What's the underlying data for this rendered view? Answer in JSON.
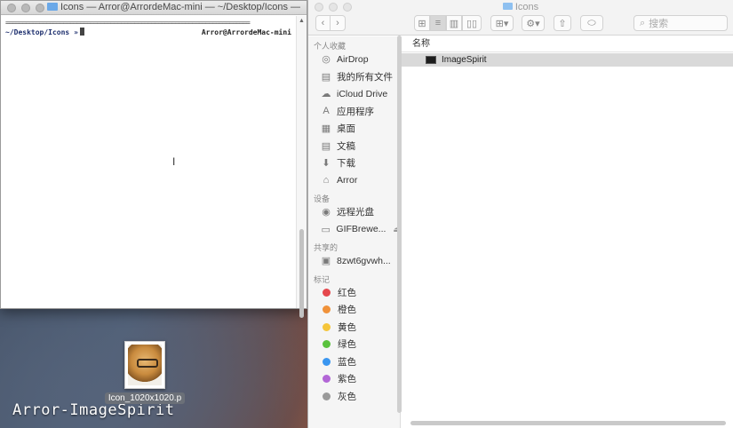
{
  "desktop": {
    "label": "Arror-ImageSpirit",
    "file_name": "Icon_1020x1020.p"
  },
  "terminal": {
    "title": "Icons — Arror@ArrordeMac-mini — ~/Desktop/Icons — -zs...",
    "rule": "========================================================================",
    "prompt": "~/Desktop/Icons »",
    "host": "Arror@ArrordeMac-mini",
    "ibeam_icon": "I"
  },
  "finder": {
    "title": "Icons",
    "search_placeholder": "搜索",
    "toolbar": {
      "back": "‹",
      "forward": "›",
      "view_icons": "⊞",
      "view_list": "≡",
      "view_columns": "▥",
      "view_cover": "▯▯",
      "arrange": "⊞▾",
      "action": "⚙▾",
      "share": "⇧",
      "tags": "⬭"
    },
    "sidebar": {
      "favorites_header": "个人收藏",
      "favorites": [
        {
          "label": "AirDrop",
          "icon": "airdrop-icon",
          "glyph": "◎"
        },
        {
          "label": "我的所有文件",
          "icon": "all-files-icon",
          "glyph": "▤"
        },
        {
          "label": "iCloud Drive",
          "icon": "icloud-icon",
          "glyph": "☁"
        },
        {
          "label": "应用程序",
          "icon": "applications-icon",
          "glyph": "A"
        },
        {
          "label": "桌面",
          "icon": "desktop-icon",
          "glyph": "▦"
        },
        {
          "label": "文稿",
          "icon": "documents-icon",
          "glyph": "▤"
        },
        {
          "label": "下载",
          "icon": "downloads-icon",
          "glyph": "⬇"
        },
        {
          "label": "Arror",
          "icon": "home-icon",
          "glyph": "⌂"
        }
      ],
      "devices_header": "设备",
      "devices": [
        {
          "label": "远程光盘",
          "icon": "remote-disc-icon",
          "glyph": "◉"
        },
        {
          "label": "GIFBrewe...",
          "icon": "disk-image-icon",
          "glyph": "▭",
          "eject": "⏏"
        }
      ],
      "shared_header": "共享的",
      "shared": [
        {
          "label": "8zwt6gvwh...",
          "icon": "computer-icon",
          "glyph": "▣"
        }
      ],
      "tags_header": "标记",
      "tags": [
        {
          "label": "红色",
          "color": "#e5484d"
        },
        {
          "label": "橙色",
          "color": "#f0923a"
        },
        {
          "label": "黄色",
          "color": "#f5c53a"
        },
        {
          "label": "绿色",
          "color": "#5ac23e"
        },
        {
          "label": "蓝色",
          "color": "#3a96f0"
        },
        {
          "label": "紫色",
          "color": "#b266d6"
        },
        {
          "label": "灰色",
          "color": "#9a9a9a"
        }
      ]
    },
    "column_header": "名称",
    "files": [
      {
        "name": "ImageSpirit",
        "icon": "executable-icon"
      }
    ]
  }
}
